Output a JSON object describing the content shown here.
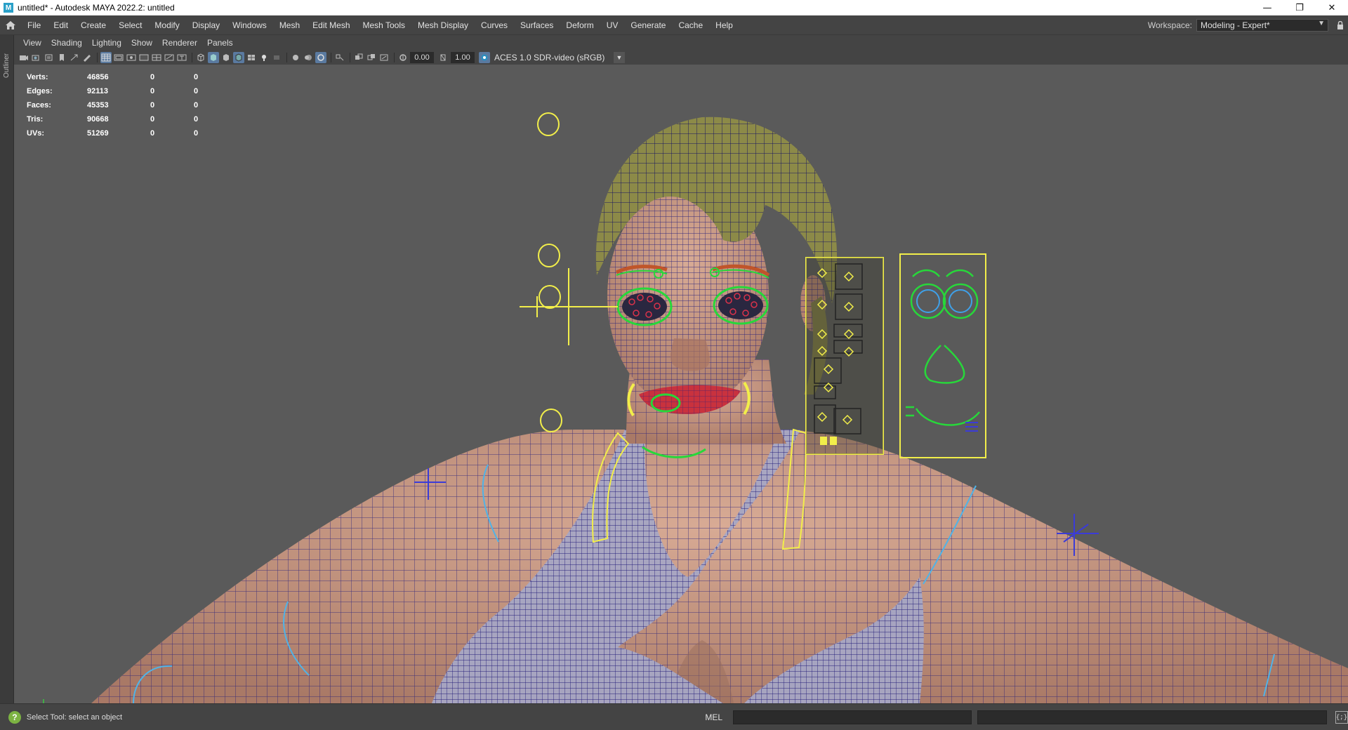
{
  "window": {
    "title": "untitled* - Autodesk MAYA 2022.2: untitled",
    "minimize_glyph": "—",
    "restore_glyph": "❐",
    "close_glyph": "✕"
  },
  "menubar": {
    "items": [
      "File",
      "Edit",
      "Create",
      "Select",
      "Modify",
      "Display",
      "Windows",
      "Mesh",
      "Edit Mesh",
      "Mesh Tools",
      "Mesh Display",
      "Curves",
      "Surfaces",
      "Deform",
      "UV",
      "Generate",
      "Cache",
      "Help"
    ]
  },
  "workspace": {
    "label": "Workspace:",
    "value": "Modeling - Expert*"
  },
  "outliner_tab": "Outliner",
  "panel_menu": {
    "items": [
      "View",
      "Shading",
      "Lighting",
      "Show",
      "Renderer",
      "Panels"
    ]
  },
  "panel_toolbar": {
    "exposure": "0.00",
    "gamma": "1.00",
    "color_management": "ACES 1.0 SDR-video (sRGB)"
  },
  "hud": {
    "rows": [
      {
        "label": "Verts:",
        "v1": "46856",
        "v2": "0",
        "v3": "0"
      },
      {
        "label": "Edges:",
        "v1": "92113",
        "v2": "0",
        "v3": "0"
      },
      {
        "label": "Faces:",
        "v1": "45353",
        "v2": "0",
        "v3": "0"
      },
      {
        "label": "Tris:",
        "v1": "90668",
        "v2": "0",
        "v3": "0"
      },
      {
        "label": "UVs:",
        "v1": "51269",
        "v2": "0",
        "v3": "0"
      }
    ]
  },
  "viewport": {
    "camera": "persp",
    "skin_color": "#c89a86",
    "wire_color": "#1f1a78",
    "control_yellow": "#f2ee4a",
    "control_green": "#27d83a"
  },
  "statusbar": {
    "help_text": "Select Tool: select an object",
    "mel_label": "MEL"
  },
  "icons": [
    "home-icon",
    "help-icon",
    "lock-icon",
    "script-editor-icon"
  ]
}
